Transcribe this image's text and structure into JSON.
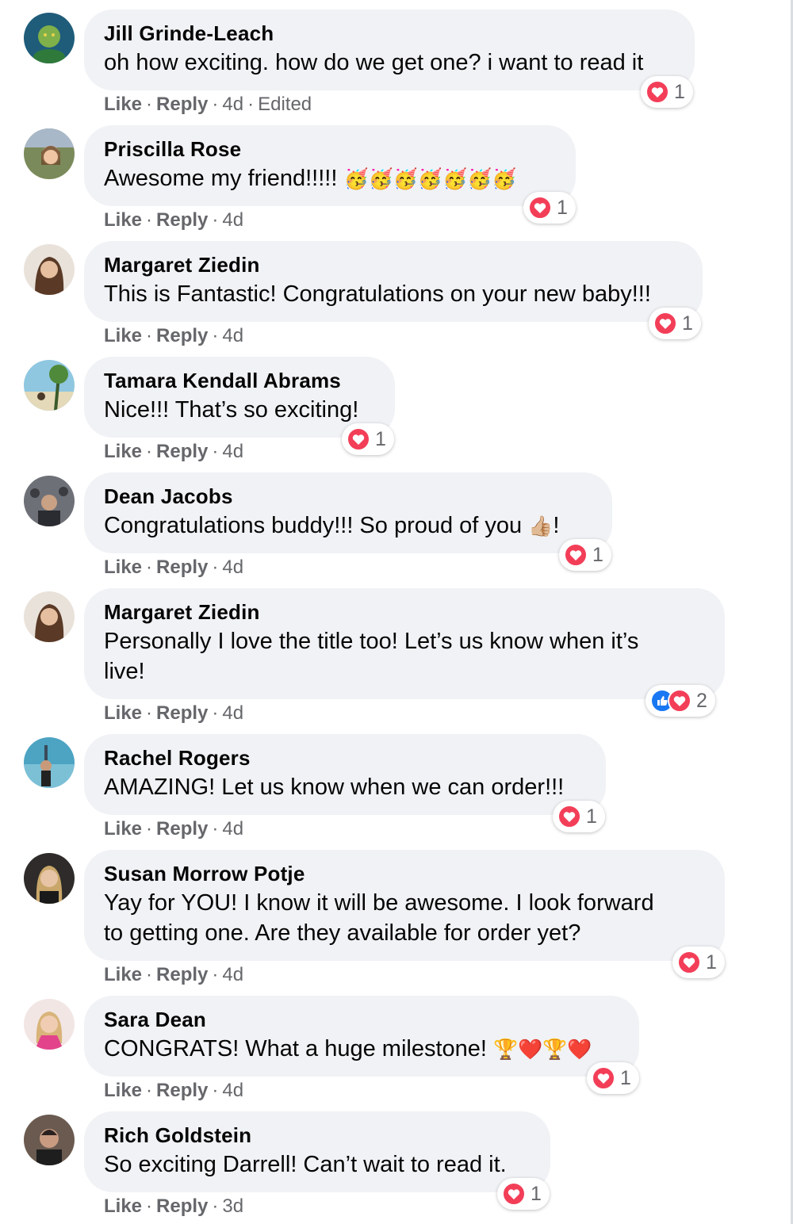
{
  "labels": {
    "like": "Like",
    "reply": "Reply"
  },
  "comments": [
    {
      "author": "Jill Grinde-Leach",
      "text": "oh how exciting. how do we get one? i want to read it",
      "time": "4d",
      "edited": "Edited",
      "reactions": [
        "love"
      ],
      "reaction_count": "1",
      "avatar_color": "#2a6e8a"
    },
    {
      "author": "Priscilla Rose",
      "text": "Awesome my friend!!!!! ",
      "emoji": "🥳🥳🥳🥳🥳🥳🥳",
      "time": "4d",
      "reactions": [
        "love"
      ],
      "reaction_count": "1",
      "avatar_color": "#6b7a4a"
    },
    {
      "author": "Margaret Ziedin",
      "text": "This is Fantastic! Congratulations on your new baby!!!",
      "time": "4d",
      "reactions": [
        "love"
      ],
      "reaction_count": "1",
      "avatar_color": "#b08b72"
    },
    {
      "author": "Tamara Kendall Abrams",
      "text": "Nice!!! That’s so exciting!",
      "time": "4d",
      "reactions": [
        "love"
      ],
      "reaction_count": "1",
      "avatar_color": "#5fa7c6"
    },
    {
      "author": "Dean Jacobs",
      "text": "Congratulations buddy!!! So proud of you ",
      "emoji": "👍🏼",
      "text_after": "!",
      "time": "4d",
      "reactions": [
        "love"
      ],
      "reaction_count": "1",
      "avatar_color": "#5a5e66"
    },
    {
      "author": "Margaret Ziedin",
      "text": "Personally I love the title too! Let’s us know when it’s\nlive!",
      "time": "4d",
      "reactions": [
        "like",
        "love"
      ],
      "reaction_count": "2",
      "avatar_color": "#b08b72"
    },
    {
      "author": "Rachel Rogers",
      "text": "AMAZING! Let us know when we can order!!!",
      "time": "4d",
      "reactions": [
        "love"
      ],
      "reaction_count": "1",
      "avatar_color": "#3e8fa8"
    },
    {
      "author": "Susan Morrow Potje",
      "text": "Yay for YOU! I know it will be awesome. I look forward\nto getting one. Are they available for order yet?",
      "time": "4d",
      "reactions": [
        "love"
      ],
      "reaction_count": "1",
      "avatar_color": "#3b3530"
    },
    {
      "author": "Sara Dean",
      "text": "CONGRATS! What a huge milestone! ",
      "emoji": "🏆❤️🏆❤️",
      "time": "4d",
      "reactions": [
        "love"
      ],
      "reaction_count": "1",
      "avatar_color": "#d9a9b5"
    },
    {
      "author": "Rich Goldstein",
      "text": "So exciting Darrell! Can’t wait to read it.",
      "time": "3d",
      "reactions": [
        "love"
      ],
      "reaction_count": "1",
      "avatar_color": "#4a3f3a"
    }
  ]
}
